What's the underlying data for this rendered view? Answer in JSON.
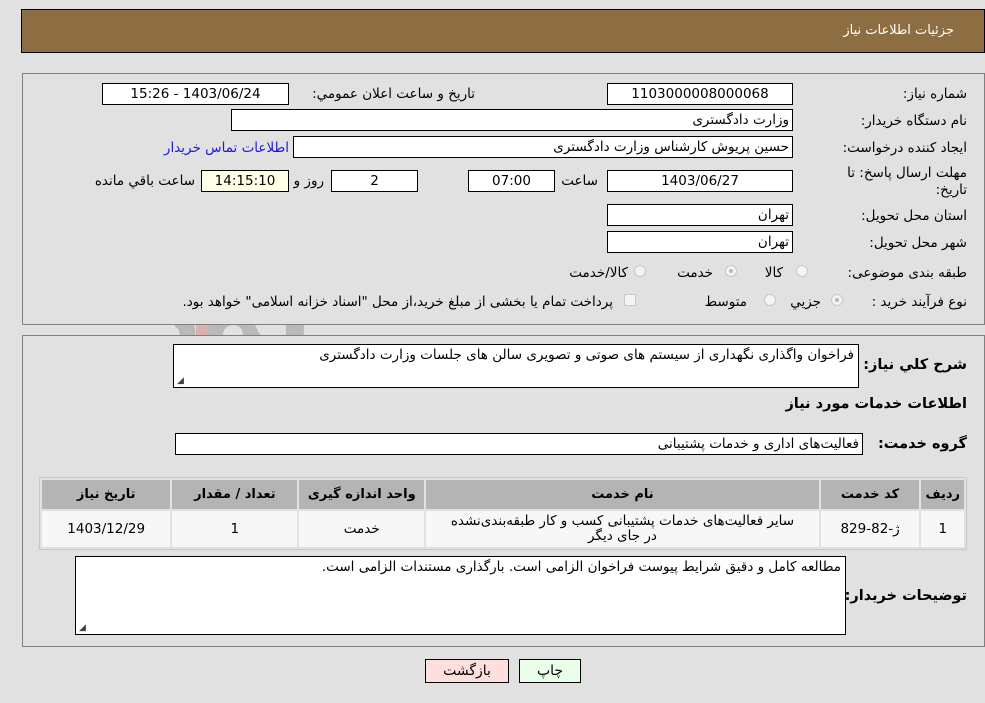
{
  "header": {
    "title": "جزئیات اطلاعات نیاز"
  },
  "form": {
    "need_number": {
      "label": "شماره نیاز:",
      "value": "1103000008000068"
    },
    "announce_datetime": {
      "label": "تاریخ و ساعت اعلان عمومي:",
      "value": "1403/06/24 - 15:26"
    },
    "buyer_org": {
      "label": "نام دستگاه خريدار:",
      "value": "وزارت دادگستری"
    },
    "requester": {
      "label": "ایجاد کننده درخواست:",
      "value": "حسین پریوش کارشناس وزارت دادگستری"
    },
    "buyer_contact_link": "اطلاعات تماس خریدار",
    "deadline": {
      "label_line1": "مهلت ارسال پاسخ: تا",
      "label_line2": "تاريخ:",
      "date": "1403/06/27",
      "time_label": "ساعت",
      "time": "07:00",
      "days": "2",
      "days_label": "روز و",
      "remaining": "14:15:10",
      "remaining_label": "ساعت باقي مانده"
    },
    "province": {
      "label": "استان محل تحویل:",
      "value": "تهران"
    },
    "city": {
      "label": "شهر محل تحویل:",
      "value": "تهران"
    },
    "category": {
      "label": "طبقه بندی موضوعی:",
      "options": [
        {
          "label": "کالا",
          "checked": false
        },
        {
          "label": "خدمت",
          "checked": true
        },
        {
          "label": "کالا/خدمت",
          "checked": false
        }
      ]
    },
    "purchase_type": {
      "label": "نوع فرآیند خرید :",
      "options": [
        {
          "label": "جزيي",
          "checked": true
        },
        {
          "label": "متوسط",
          "checked": false
        }
      ],
      "treasury_checkbox": "پرداخت تمام یا بخشی از مبلغ خرید،از محل \"اسناد خزانه اسلامی\" خواهد بود."
    }
  },
  "description": {
    "label": "شرح کلي نياز:",
    "value": "فراخوان واگذاری نگهداری از سیستم های صوتی و تصویری سالن های جلسات وزارت دادگستری"
  },
  "services_section": {
    "title": "اطلاعات خدمات مورد نیاز",
    "group_label": "گروه خدمت:",
    "group_value": "فعالیت‌های اداری و خدمات پشتیبانی",
    "table": {
      "headers": [
        "ردیف",
        "کد خدمت",
        "نام خدمت",
        "واحد اندازه گیری",
        "تعداد / مقدار",
        "تاریخ نیاز"
      ],
      "rows": [
        {
          "index": "1",
          "code": "ژ-82-829",
          "name_line1": "سایر فعالیت‌های خدمات پشتیبانی کسب و کار طبقه‌بندی‌نشده",
          "name_line2": "در جای دیگر",
          "unit": "خدمت",
          "quantity": "1",
          "date": "1403/12/29"
        }
      ]
    }
  },
  "buyer_notes": {
    "label": "توضیحات خریدار:",
    "value": "مطالعه کامل و دقیق شرایط پیوست فراخوان الزامی است. بارگذاری مستندات الزامی است."
  },
  "buttons": {
    "print": "چاپ",
    "back": "بازگشت"
  },
  "watermark": "AriaTender.neT",
  "colors": {
    "header_bg": "#8d6e42",
    "print_bg": "#eaffea",
    "back_bg": "#ffdede",
    "link": "#1a1ad6"
  }
}
